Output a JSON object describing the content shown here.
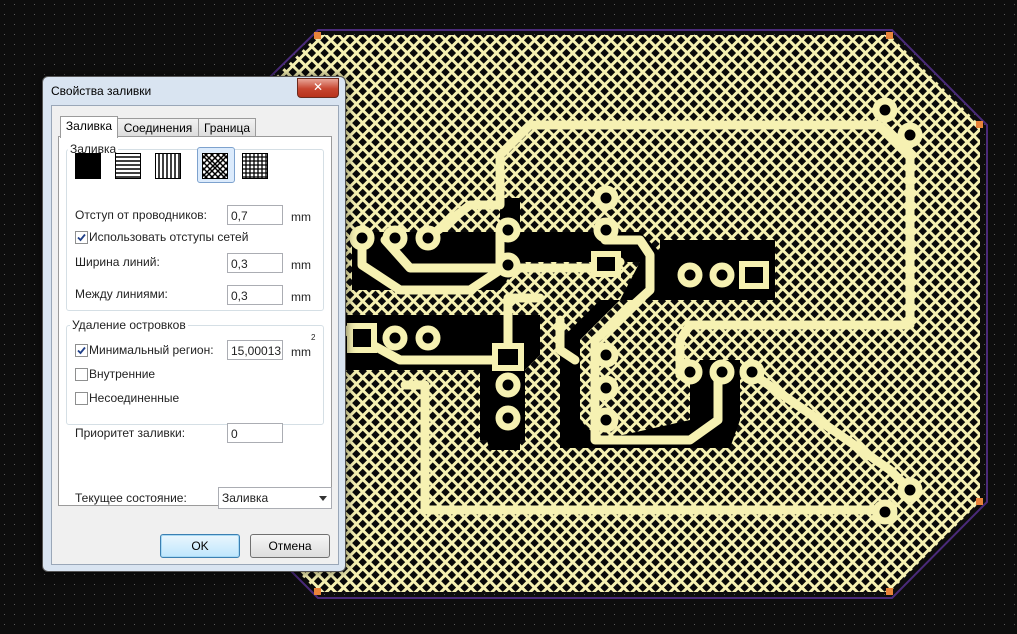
{
  "dialog": {
    "title": "Свойства заливки",
    "close_glyph": "✕",
    "tabs": [
      {
        "label": "Заливка",
        "active": true
      },
      {
        "label": "Соединения",
        "active": false
      },
      {
        "label": "Граница",
        "active": false
      }
    ],
    "fill_group": {
      "label": "Заливка",
      "patterns": [
        "solid-fill-icon",
        "horizontal-hatch-icon",
        "vertical-hatch-icon",
        "diagonal-crosshatch-icon",
        "crosshatch-icon"
      ],
      "selected_pattern": 3
    },
    "clearance": {
      "label": "Отступ от проводников:",
      "value": "0,7",
      "unit": "mm"
    },
    "use_net_clearances": {
      "label": "Использовать отступы сетей",
      "checked": true
    },
    "line_width": {
      "label": "Ширина линий:",
      "value": "0,3",
      "unit": "mm"
    },
    "line_spacing": {
      "label": "Между линиями:",
      "value": "0,3",
      "unit": "mm"
    },
    "islands_group": {
      "label": "Удаление островков",
      "min_region": {
        "label": "Минимальный регион:",
        "value": "15,00013",
        "unit": "mm",
        "superscript": "2",
        "checked": true
      },
      "internal": {
        "label": "Внутренние",
        "checked": false
      },
      "unconnected": {
        "label": "Несоединенные",
        "checked": false
      }
    },
    "priority": {
      "label": "Приоритет заливки:",
      "value": "0"
    },
    "state": {
      "label": "Текущее состояние:",
      "value": "Заливка"
    },
    "ok_label": "OK",
    "cancel_label": "Отмена"
  },
  "colors": {
    "background": "#0d0d0d",
    "board_fill": "#f6f1b2",
    "copper": "#000000",
    "outline": "#4a2a7a",
    "corner_marker": "#e8833a",
    "dialog_frame": "#d9e4f1"
  }
}
